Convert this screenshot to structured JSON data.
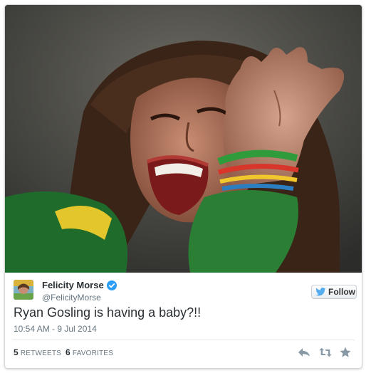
{
  "tweet": {
    "author": {
      "display_name": "Felicity Morse",
      "handle": "@FelicityMorse",
      "verified": true,
      "avatar_icon": "avatar-photo"
    },
    "follow_label": "Follow",
    "text": "Ryan Gosling is having a baby?!!",
    "timestamp": "10:54 AM - 9 Jul 2014",
    "stats": {
      "retweets_count": "5",
      "retweets_label": "RETWEETS",
      "favorites_count": "6",
      "favorites_label": "FAVORITES"
    },
    "actions": {
      "reply_icon": "reply-icon",
      "retweet_icon": "retweet-icon",
      "favorite_icon": "star-icon"
    }
  },
  "colors": {
    "twitter_blue": "#55acee",
    "verified_blue": "#2a9df4",
    "text_primary": "#292f33",
    "text_secondary": "#66757f",
    "action_gray": "#8899a6"
  }
}
